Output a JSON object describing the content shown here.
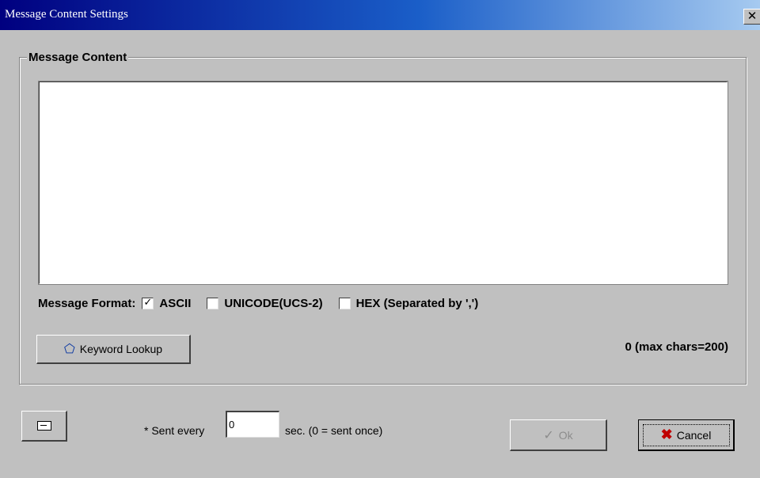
{
  "window": {
    "title": "Message Content Settings",
    "close_glyph": "✕"
  },
  "message_content": {
    "group_label": "Message Content",
    "text_value": ""
  },
  "format": {
    "label": "Message Format:",
    "options": [
      {
        "label": "ASCII",
        "checked": true
      },
      {
        "label": "UNICODE(UCS-2)",
        "checked": false
      },
      {
        "label": "HEX (Separated by ',')",
        "checked": false
      }
    ],
    "check_glyph": "✓"
  },
  "keyword_button": {
    "label": "Keyword Lookup",
    "icon": "eraser-icon"
  },
  "char_count": "0 (max chars=200)",
  "sent_every": {
    "prefix": "* Sent every",
    "value": "0",
    "suffix": "sec. (0 = sent once)"
  },
  "buttons": {
    "ok_label": "Ok",
    "cancel_label": "Cancel"
  },
  "colors": {
    "window_bg": "#c0c0c0",
    "titlebar_start": "#000080",
    "titlebar_end": "#a6caf0",
    "cancel_icon": "#c00000",
    "disabled_text": "#8c8c8c"
  }
}
